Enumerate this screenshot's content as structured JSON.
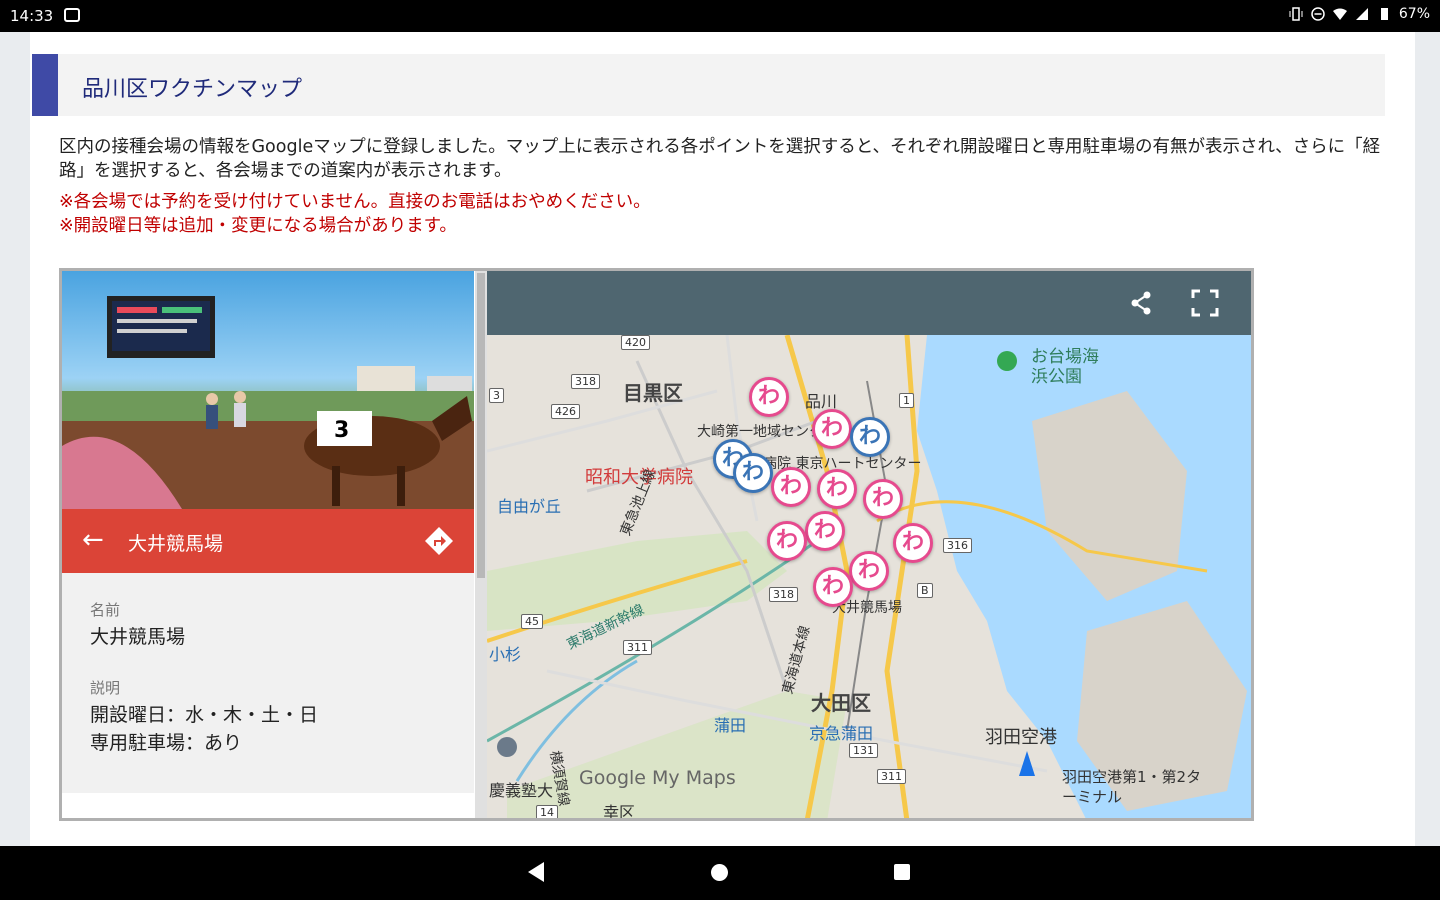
{
  "status_bar": {
    "time": "14:33",
    "battery": "67%"
  },
  "section": {
    "title": "品川区ワクチンマップ"
  },
  "description": "区内の接種会場の情報をGoogleマップに登録しました。マップ上に表示される各ポイントを選択すると、それぞれ開設曜日と専用駐車場の有無が表示され、さらに「経路」を選択すると、各会場までの道案内が表示されます。",
  "notes": [
    "※各会場では予約を受け付けていません。直接のお電話はおやめください。",
    "※開設曜日等は追加・変更になる場合があります。"
  ],
  "place": {
    "header_name": "大井競馬場",
    "name_label": "名前",
    "name_value": "大井競馬場",
    "desc_label": "説明",
    "desc_line1": "開設曜日：水・木・土・日",
    "desc_line2": "専用駐車場：あり"
  },
  "map": {
    "labels": {
      "meguro": "目黒区",
      "shinagawa": "品川",
      "odaiba": "お台場海浜公園",
      "osaki_center": "大崎第一地域センター",
      "osaki_hospital": "大崎病院 東京ハートセンター",
      "showa": "昭和大学病院",
      "jiyugaoka": "自由が丘",
      "tokyu_ikegami": "東急池上線",
      "tokaido_shinkansen": "東海道新幹線",
      "kosugi": "小杉",
      "tokaido_main": "東海道本線",
      "oi_keibajo": "大井競馬場",
      "ota": "大田区",
      "kamata": "蒲田",
      "keikyu_kamata": "京急蒲田",
      "haneda": "羽田空港",
      "haneda_terminal": "羽田空港第1・第2ターミナル",
      "yokosuka": "横須賀線",
      "gijuku": "慶義塾大",
      "saiwai": "幸区"
    },
    "shields": [
      "420",
      "318",
      "3",
      "426",
      "1",
      "316",
      "318",
      "45",
      "311",
      "131",
      "311",
      "14",
      "B"
    ],
    "watermark": "Google My Maps",
    "marker_glyph": "わ"
  },
  "colors": {
    "accent": "#3f4aa6",
    "note_red": "#c00000",
    "header_red": "#db4437"
  }
}
